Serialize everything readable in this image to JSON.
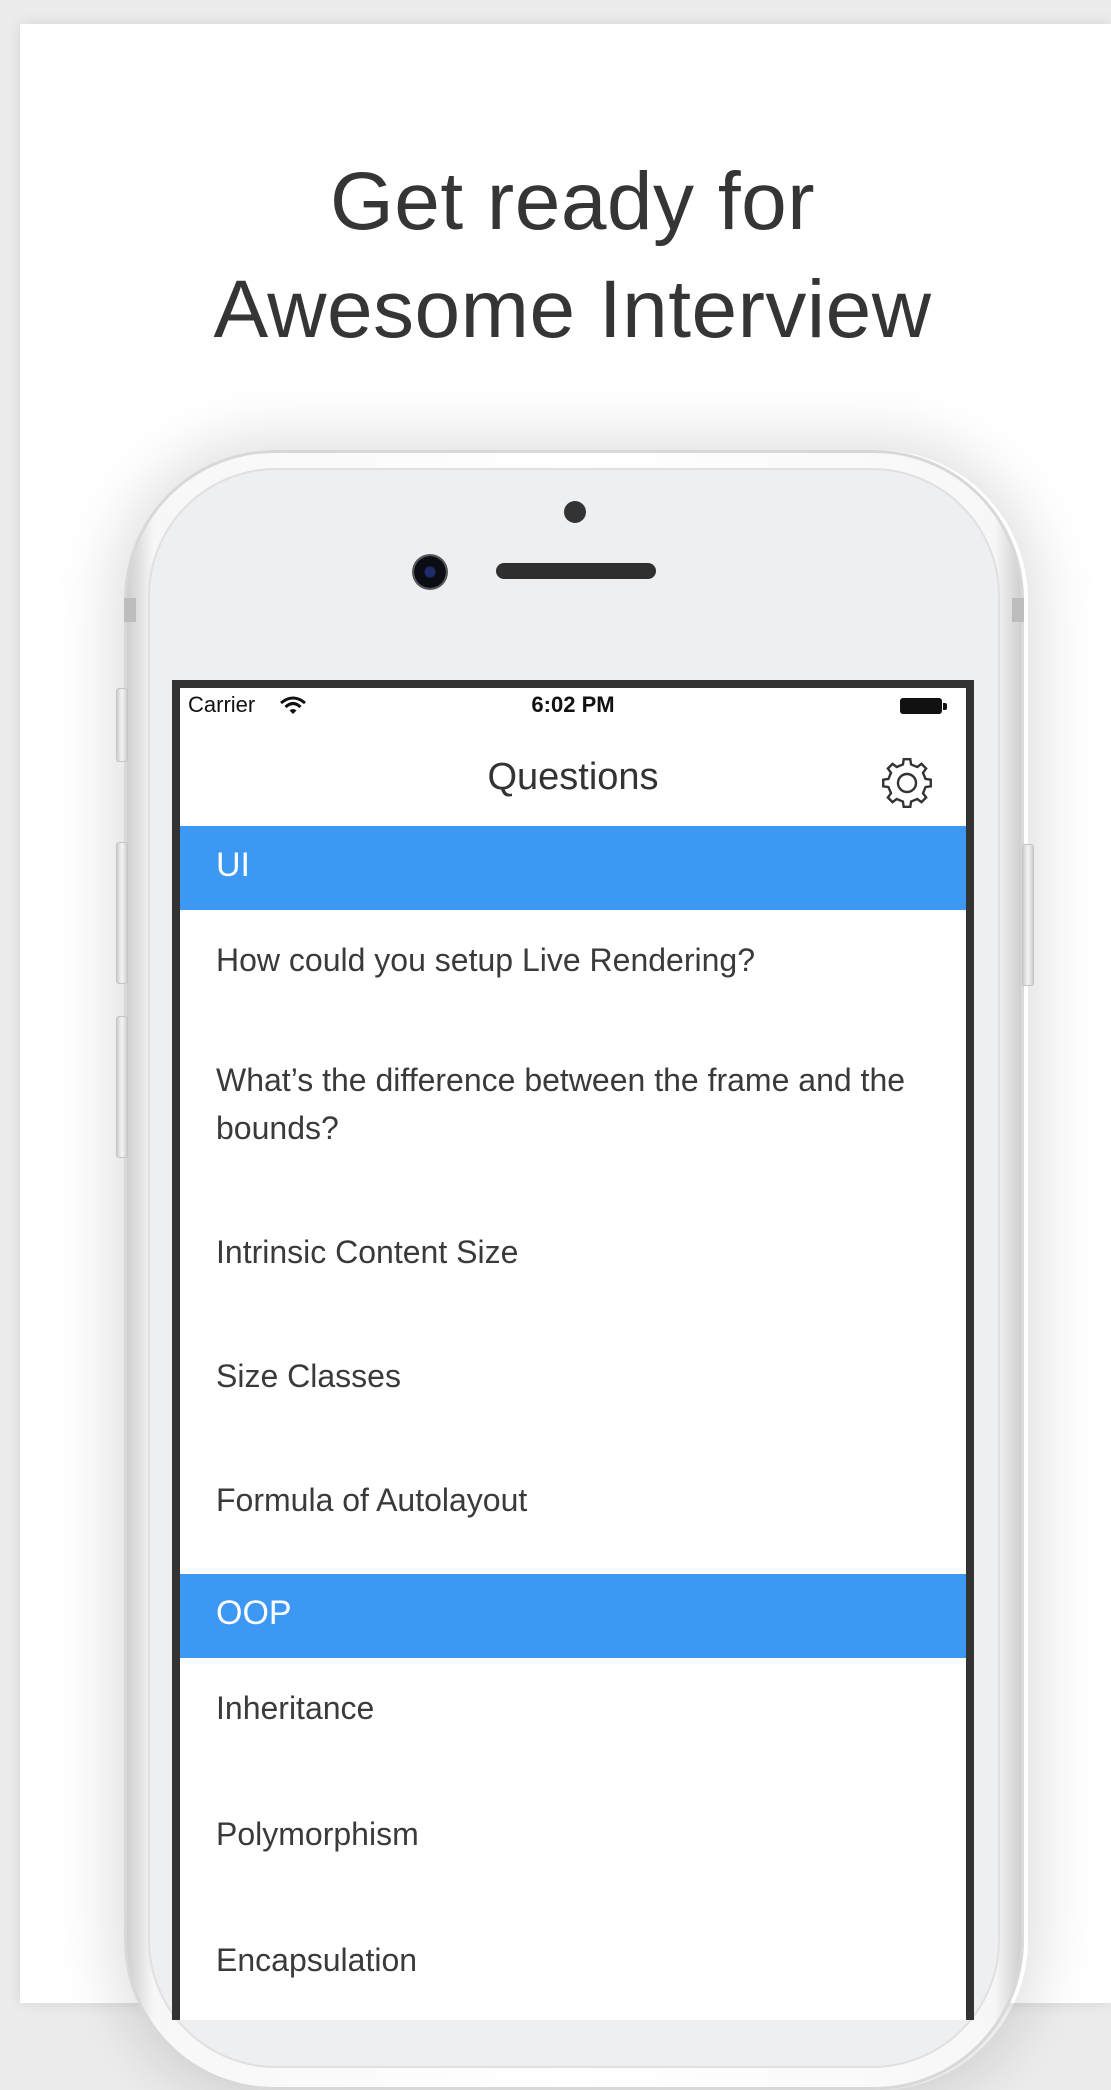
{
  "headline": {
    "line1": "Get ready for",
    "line2": "Awesome Interview"
  },
  "status_bar": {
    "carrier": "Carrier",
    "time": "6:02 PM",
    "icons": [
      "wifi-icon",
      "battery-icon"
    ]
  },
  "nav": {
    "title": "Questions",
    "settings_icon": "gear-icon"
  },
  "colors": {
    "section_header": "#3d98f4",
    "text": "#3a3a3a"
  },
  "sections": [
    {
      "title": "UI",
      "items": [
        "How could you setup Live Rendering?",
        "What’s the difference between the frame and the bounds?",
        "Intrinsic Content Size",
        "Size Classes",
        "Formula of Autolayout"
      ]
    },
    {
      "title": "OOP",
      "items": [
        "Inheritance",
        "Polymorphism",
        "Encapsulation"
      ]
    }
  ]
}
